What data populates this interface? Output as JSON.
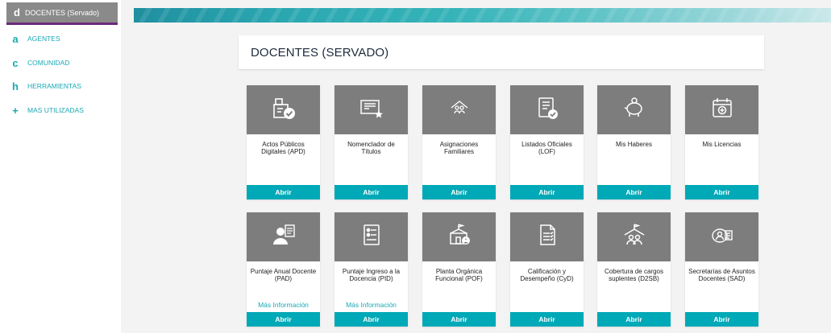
{
  "sidebar": {
    "active": {
      "glyph": "d",
      "label": "DOCENTES (Servado)"
    },
    "items": [
      {
        "glyph": "a",
        "label": "AGENTES"
      },
      {
        "glyph": "c",
        "label": "COMUNIDAD"
      },
      {
        "glyph": "h",
        "label": "HERRAMIENTAS"
      },
      {
        "glyph": "+",
        "label": "MAS UTILIZADAS"
      }
    ]
  },
  "page": {
    "title": "DOCENTES (SERVADO)"
  },
  "colors": {
    "accent": "#00a9b7",
    "card_header": "#7d7d7d",
    "active_underline": "#6b2a7a"
  },
  "cards": [
    {
      "label": "Actos Públicos Digitales (APD)",
      "button": "Abrir",
      "icon": "id-badge-check-icon"
    },
    {
      "label": "Nomenclador de Títulos",
      "button": "Abrir",
      "icon": "certificate-star-icon"
    },
    {
      "label": "Asignaciones Familiares",
      "button": "Abrir",
      "icon": "family-house-icon"
    },
    {
      "label": "Listados Oficiales (LOF)",
      "button": "Abrir",
      "icon": "list-document-check-icon"
    },
    {
      "label": "Mis Haberes",
      "button": "Abrir",
      "icon": "piggy-bank-icon"
    },
    {
      "label": "Mis Licencias",
      "button": "Abrir",
      "icon": "calendar-plus-icon"
    },
    {
      "label": "Puntaje Anual Docente (PAD)",
      "button": "Abrir",
      "info": "Más Información",
      "icon": "person-document-icon"
    },
    {
      "label": "Puntaje Ingreso a la Docencia (PID)",
      "button": "Abrir",
      "info": "Más Información",
      "icon": "id-list-document-icon"
    },
    {
      "label": "Planta Orgánica Funcional (POF)",
      "button": "Abrir",
      "icon": "school-building-icon"
    },
    {
      "label": "Calificación y Desempeño (CyD)",
      "button": "Abrir",
      "icon": "evaluation-document-icon"
    },
    {
      "label": "Cobertura de cargos suplentes (D2SB)",
      "button": "Abrir",
      "icon": "school-people-icon"
    },
    {
      "label": "Secretarías de Asuntos Docentes (SAD)",
      "button": "Abrir",
      "icon": "secretary-people-icon"
    }
  ]
}
